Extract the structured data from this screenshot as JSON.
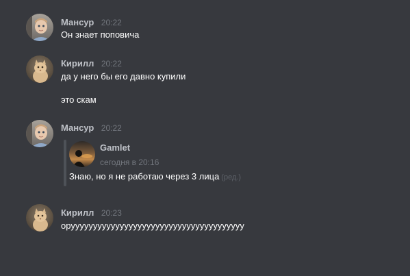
{
  "messages": [
    {
      "author": "Мансур",
      "time": "20:22",
      "lines": [
        "Он знает поповича"
      ]
    },
    {
      "author": "Кирилл",
      "time": "20:22",
      "lines": [
        "да у него бы его давно купили",
        "это скам"
      ]
    },
    {
      "author": "Мансур",
      "time": "20:22",
      "quote": {
        "author": "Gamlet",
        "time": "сегодня в 20:16",
        "text": "Знаю, но я не работаю через 3 лица",
        "edited": "(ред.)"
      }
    },
    {
      "author": "Кирилл",
      "time": "20:23",
      "lines": [
        "орууууууууууууууууууууууууууууууууууууууу"
      ]
    }
  ],
  "colors": {
    "background": "#37393e",
    "username": "#bfc2c8",
    "timestamp": "#72767d",
    "text": "#ffffff",
    "quote_bar": "#4e5258"
  },
  "icons": {
    "avatar_mansur": "child-avatar-icon",
    "avatar_kirill": "cat-avatar-icon",
    "avatar_gamlet": "silhouette-sunset-avatar-icon"
  }
}
